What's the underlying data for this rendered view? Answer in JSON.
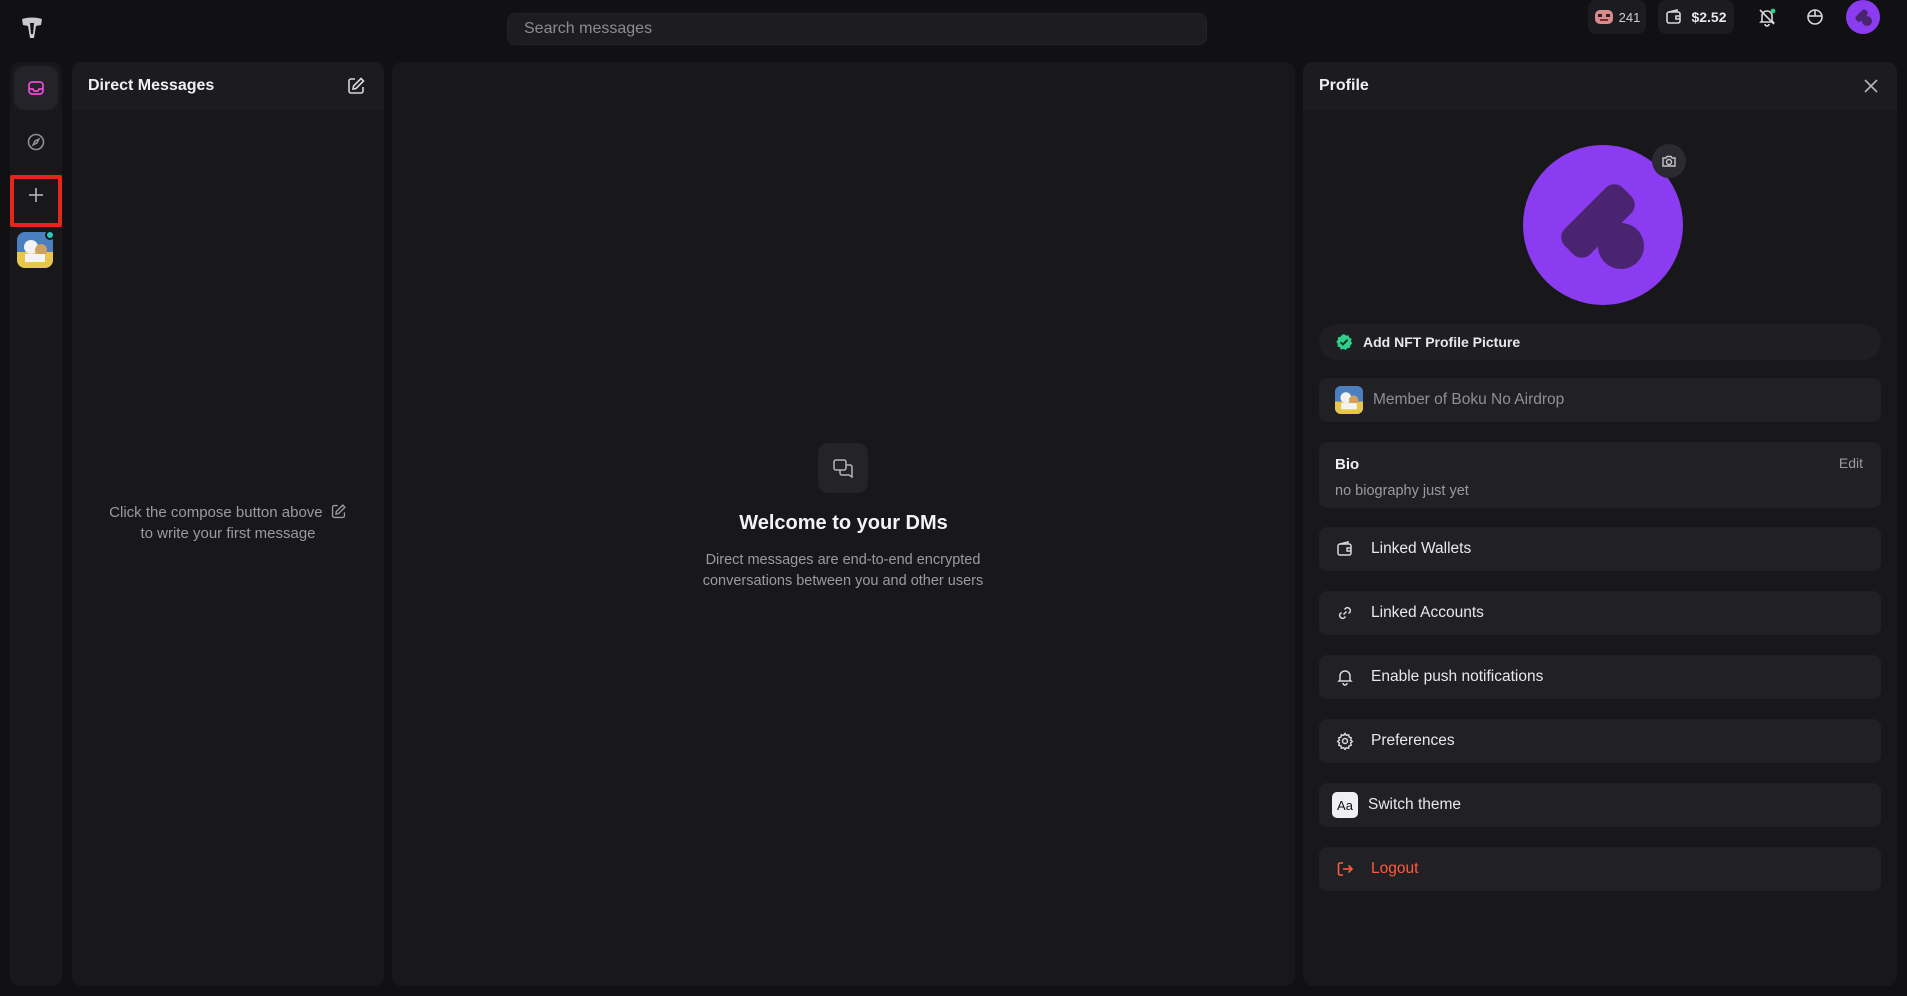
{
  "topbar": {
    "search_placeholder": "Search messages",
    "points_count": "241",
    "wallet_balance": "$2.52"
  },
  "rail": {
    "items": [
      "inbox-icon",
      "compass-icon",
      "plus-icon",
      "server-avatar"
    ],
    "active": "inbox",
    "highlight_color": "#e4271d"
  },
  "dm": {
    "title": "Direct Messages",
    "empty_line1": "Click the compose button above",
    "empty_line2": "to write your first message"
  },
  "welcome": {
    "title": "Welcome to your DMs",
    "text": "Direct messages are end-to-end encrypted conversations between you and other users"
  },
  "profile": {
    "title": "Profile",
    "nft_label": "Add NFT Profile Picture",
    "member_label": "Member of Boku No Airdrop",
    "bio_label": "Bio",
    "bio_edit": "Edit",
    "bio_text": "no biography just yet",
    "menu": {
      "linked_wallets": "Linked Wallets",
      "linked_accounts": "Linked Accounts",
      "push": "Enable push notifications",
      "preferences": "Preferences",
      "theme": "Switch theme",
      "theme_icon_text": "Aa",
      "logout": "Logout"
    }
  },
  "colors": {
    "accent": "#8b3cf0",
    "logout": "#ff5a3c",
    "check": "#2fd08a"
  }
}
